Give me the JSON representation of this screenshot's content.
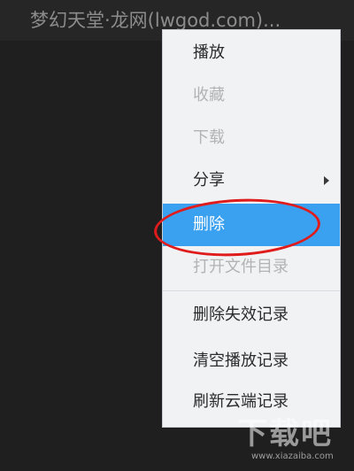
{
  "window": {
    "title": "梦幻天堂·龙网(lwgod.com)..."
  },
  "context_menu": {
    "items": [
      {
        "label": "播放",
        "state": "enabled"
      },
      {
        "label": "收藏",
        "state": "disabled"
      },
      {
        "label": "下载",
        "state": "disabled"
      },
      {
        "label": "分享",
        "state": "enabled",
        "has_submenu": true
      },
      {
        "label": "删除",
        "state": "selected"
      },
      {
        "label": "打开文件目录",
        "state": "disabled"
      },
      {
        "label": "删除失效记录",
        "state": "enabled"
      },
      {
        "label": "清空播放记录",
        "state": "enabled"
      },
      {
        "label": "刷新云端记录",
        "state": "enabled"
      }
    ]
  },
  "watermark": {
    "name": "下载吧",
    "url": "www.xiazaiba.com"
  },
  "colors": {
    "background": "#1f1f1f",
    "menu_background": "#f1f2f4",
    "selected": "#3aa0f0",
    "annotation": "#e01b1b"
  }
}
